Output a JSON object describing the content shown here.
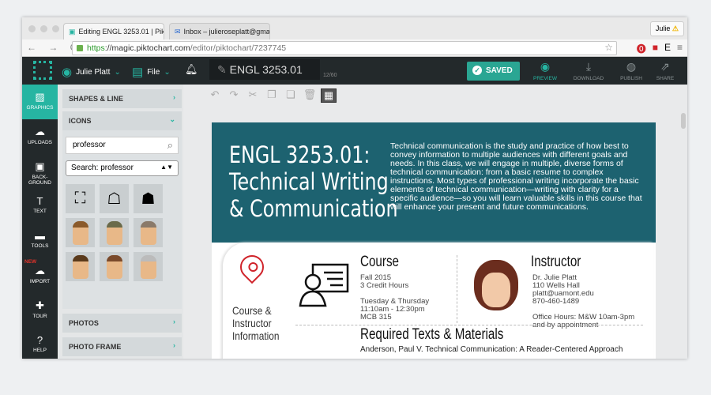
{
  "browser": {
    "tabs": [
      {
        "label": "Editing ENGL 3253.01 | Pik",
        "icon": "piktochart-icon"
      },
      {
        "label": "Inbox – julieroseplatt@gma",
        "icon": "mail-icon"
      }
    ],
    "profile": "Julie",
    "url": {
      "scheme": "https",
      "host": "://magic.piktochart.com",
      "path": "/editor/piktochart/7237745"
    }
  },
  "toolbar": {
    "user": "Julie Platt",
    "file": "File",
    "doc_title": "ENGL 3253.01",
    "char_count": "12/60",
    "saved": "SAVED",
    "actions": [
      {
        "label": "PREVIEW",
        "icon": "eye-icon"
      },
      {
        "label": "DOWNLOAD",
        "icon": "download-icon"
      },
      {
        "label": "PUBLISH",
        "icon": "globe-icon"
      },
      {
        "label": "SHARE",
        "icon": "share-icon"
      }
    ]
  },
  "sidebar": {
    "items": [
      {
        "label": "GRAPHICS"
      },
      {
        "label": "UPLOADS"
      },
      {
        "label": "BACK-GROUND"
      },
      {
        "label": "TEXT"
      },
      {
        "label": "TOOLS"
      },
      {
        "label": "IMPORT",
        "badge": "NEW"
      },
      {
        "label": "TOUR"
      },
      {
        "label": "HELP"
      }
    ]
  },
  "panel": {
    "shapes": "SHAPES & LINE",
    "icons": "ICONS",
    "search_value": "professor",
    "select_value": "Search: professor",
    "photos": "PHOTOS",
    "photo_frame": "PHOTO FRAME"
  },
  "canvas": {
    "title_lines": [
      "ENGL 3253.01:",
      "Technical Writing",
      "& Communication"
    ],
    "description": "Technical communication is the study and practice of how best to convey information to multiple audiences with different goals and needs. In this class, we will engage in multiple, diverse forms of technical communication: from a basic resume to complex instructions. Most types of professional writing incorporate the basic elements of technical communication—writing with clarity for a specific audience—so you will learn valuable skills in this course that will enhance your present and future communications.",
    "section_label_lines": [
      "Course &",
      "Instructor",
      "Information"
    ],
    "course": {
      "heading": "Course",
      "lines1": [
        "Fall 2015",
        "3 Credit Hours"
      ],
      "lines2": [
        "Tuesday & Thursday",
        "11:10am - 12:30pm",
        "MCB 315"
      ]
    },
    "instructor": {
      "heading": "Instructor",
      "lines1": [
        "Dr. Julie Platt",
        "110 Wells Hall",
        "platt@uamont.edu",
        "870-460-1489"
      ],
      "lines2": [
        "Office Hours: M&W 10am-3pm",
        "and by appointment"
      ]
    },
    "texts_heading": "Required Texts & Materials",
    "texts_first": "Anderson, Paul V. Technical Communication: A Reader-Centered Approach"
  },
  "colors": {
    "accent": "#26b5a2",
    "header_bg": "#1d6270",
    "appbar": "#23292b",
    "pin": "#d0232a"
  }
}
